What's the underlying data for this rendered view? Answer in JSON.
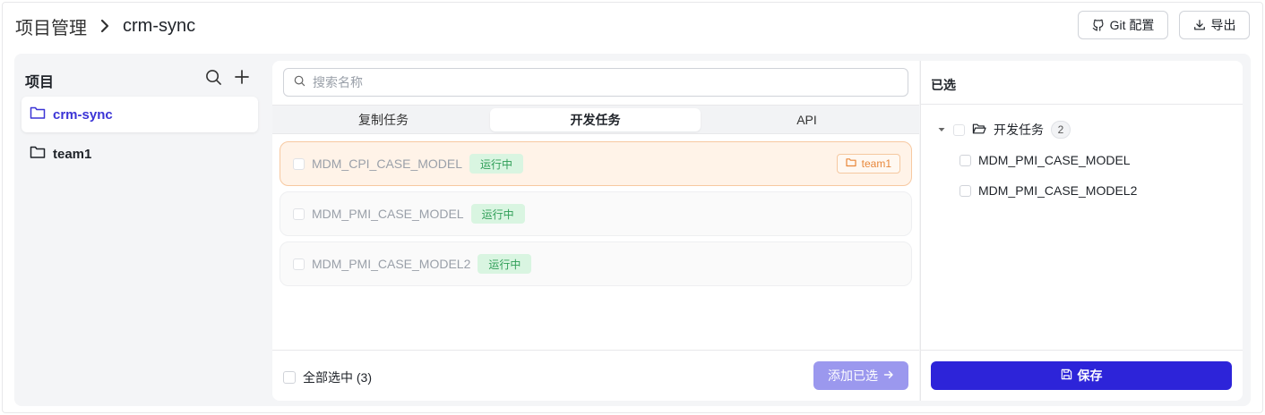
{
  "header": {
    "breadcrumb_root": "项目管理",
    "breadcrumb_current": "crm-sync",
    "git_config_label": "Git 配置",
    "export_label": "导出"
  },
  "sidebar": {
    "title": "项目",
    "items": [
      {
        "label": "crm-sync",
        "active": true
      },
      {
        "label": "team1",
        "active": false
      }
    ]
  },
  "search": {
    "placeholder": "搜索名称"
  },
  "tabs": [
    {
      "label": "复制任务",
      "active": false
    },
    {
      "label": "开发任务",
      "active": true
    },
    {
      "label": "API",
      "active": false
    }
  ],
  "tasks": [
    {
      "name": "MDM_CPI_CASE_MODEL",
      "status": "运行中",
      "folder": "team1",
      "highlighted": true
    },
    {
      "name": "MDM_PMI_CASE_MODEL",
      "status": "运行中"
    },
    {
      "name": "MDM_PMI_CASE_MODEL2",
      "status": "运行中"
    }
  ],
  "footer": {
    "select_all_label": "全部选中 (3)",
    "add_selected_label": "添加已选"
  },
  "selected_panel": {
    "title": "已选",
    "group_label": "开发任务",
    "group_count": "2",
    "items": [
      "MDM_PMI_CASE_MODEL",
      "MDM_PMI_CASE_MODEL2"
    ],
    "save_label": "保存"
  },
  "colors": {
    "accent": "#2d24d9",
    "accent_light": "#9b98ee",
    "running_bg": "#d9f5e1",
    "running_text": "#2f9e57",
    "highlight_bg": "#fff3e8",
    "folder_tag": "#e8873a"
  }
}
